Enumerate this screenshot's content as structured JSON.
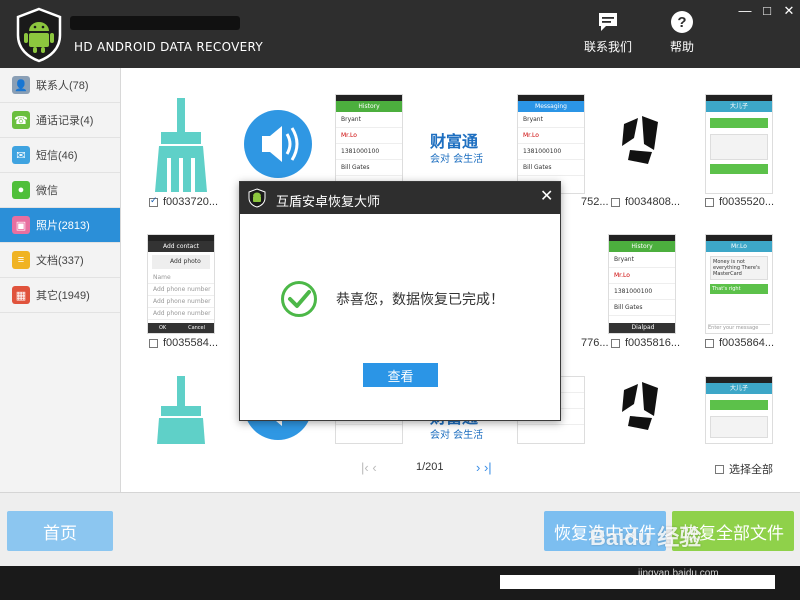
{
  "app": {
    "name": "HD ANDROID DATA RECOVERY"
  },
  "header": {
    "contact_label": "联系我们",
    "help_label": "帮助"
  },
  "window_controls": {
    "minimize": "—",
    "maximize": "□",
    "close": "✕"
  },
  "sidebar": {
    "items": [
      {
        "label": "联系人(78)",
        "icon": "contacts-icon",
        "color": "#8a9fb5",
        "active": false
      },
      {
        "label": "通话记录(4)",
        "icon": "phone-icon",
        "color": "#6abf3e",
        "active": false
      },
      {
        "label": "短信(46)",
        "icon": "sms-icon",
        "color": "#3fa3e0",
        "active": false
      },
      {
        "label": "微信",
        "icon": "wechat-icon",
        "color": "#4fbf3a",
        "active": false
      },
      {
        "label": "照片(2813)",
        "icon": "photo-icon",
        "color": "#e86fa0",
        "active": true
      },
      {
        "label": "文档(337)",
        "icon": "document-icon",
        "color": "#f0b323",
        "active": false
      },
      {
        "label": "其它(1949)",
        "icon": "other-icon",
        "color": "#e0533c",
        "active": false
      }
    ]
  },
  "grid": {
    "row1_captions": [
      "f0033720...",
      "",
      "",
      "752...",
      "f0034808...",
      "",
      "f0035520..."
    ],
    "row2_captions": [
      "f0035584...",
      "",
      "",
      "776...",
      "f0035816...",
      "",
      "f0035864..."
    ],
    "phone_history": {
      "title": "History",
      "rows": [
        "Bryant",
        "Mr.Lo",
        "1381000100",
        "Bill Gates"
      ],
      "dialpad": "Dialpad"
    },
    "phone_messaging": {
      "title": "Messaging",
      "rows": [
        "Bryant",
        "Mr.Lo",
        "1381000100",
        "Bill Gates"
      ]
    },
    "phone_contact": {
      "title": "Add contact",
      "add_photo": "Add photo",
      "rows": [
        "Name",
        "Add phone number",
        "Add phone number",
        "Add phone number"
      ],
      "ok": "OK",
      "cancel": "Cancel"
    },
    "phone_chat1": {
      "title": "大儿子"
    },
    "phone_chat2": {
      "title": "Mr.Lo",
      "msg1": "Money is not everything There's MasterCard",
      "msg2": "That's right",
      "input": "Enter your message"
    },
    "logo_text": "财富通",
    "logo_sub": "会对 会生活"
  },
  "pager": {
    "prev": "|‹ ‹",
    "text": "1/201",
    "next": "› ›|",
    "select_all": "选择全部"
  },
  "bottom": {
    "home": "首页",
    "recover_selected": "恢复选中文件",
    "recover_all": "恢复全部文件"
  },
  "watermark": {
    "text": "Baidu 经验",
    "sub": "jingyan.baidu.com"
  },
  "modal": {
    "title": "互盾安卓恢复大师",
    "close": "✕",
    "message": "恭喜您，数据恢复已完成！",
    "view_button": "查看"
  },
  "colors": {
    "accent": "#2b95e6",
    "active_sidebar": "#2b8fd8",
    "green": "#8fd14a",
    "header": "#2e2e2e"
  }
}
